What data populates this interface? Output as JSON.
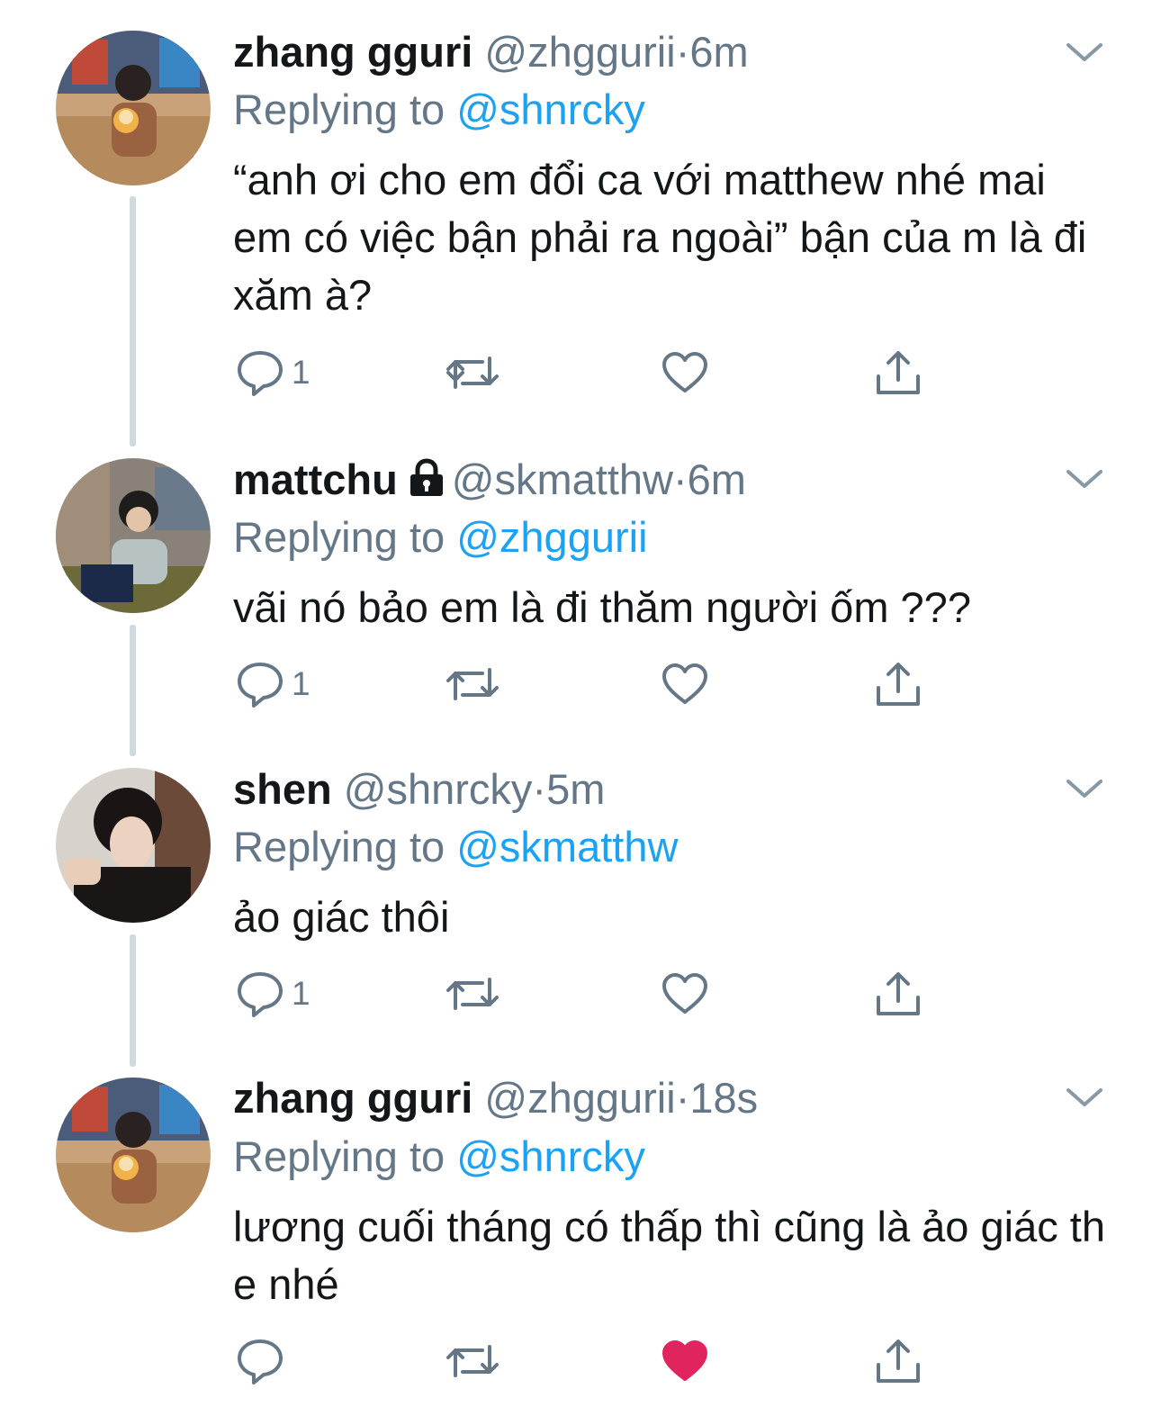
{
  "tweets": [
    {
      "display_name": "zhang gguri",
      "handle": "@zhggurii",
      "separator": "·",
      "time": "6m",
      "protected": false,
      "avatar_icon": "avatar-photo",
      "replying_prefix": "Replying to",
      "replying_to": "@shnrcky",
      "text": "“anh ơi cho em đổi ca với matthew nhé mai em có việc bận phải ra ngoài” bận của m là đi xăm à?",
      "reply_count": "1",
      "liked": false
    },
    {
      "display_name": "mattchu",
      "handle": "@skmatthw",
      "separator": "·",
      "time": "6m",
      "protected": true,
      "avatar_icon": "avatar-photo",
      "replying_prefix": "Replying to",
      "replying_to": "@zhggurii",
      "text": "vãi nó bảo em là đi thăm người ốm ???",
      "reply_count": "1",
      "liked": false
    },
    {
      "display_name": "shen",
      "handle": "@shnrcky",
      "separator": "·",
      "time": "5m",
      "protected": false,
      "avatar_icon": "avatar-photo",
      "replying_prefix": "Replying to",
      "replying_to": "@skmatthw",
      "text": "ảo giác thôi",
      "reply_count": "1",
      "liked": false
    },
    {
      "display_name": "zhang gguri",
      "handle": "@zhggurii",
      "separator": "·",
      "time": "18s",
      "protected": false,
      "avatar_icon": "avatar-photo",
      "replying_prefix": "Replying to",
      "replying_to": "@shnrcky",
      "text": "lương cuối tháng có thấp thì cũng là ảo giác th e nhé",
      "reply_count": "",
      "liked": true
    }
  ],
  "icons": {
    "reply": "reply-bubble-icon",
    "retweet": "retweet-icon",
    "like": "heart-icon",
    "share": "share-icon",
    "more": "chevron-down-icon",
    "protected": "lock-icon"
  },
  "colors": {
    "text": "#14171a",
    "secondary": "#657786",
    "link": "#1da1f2",
    "like_active": "#e0245e",
    "thread_line": "#cfd9de"
  }
}
